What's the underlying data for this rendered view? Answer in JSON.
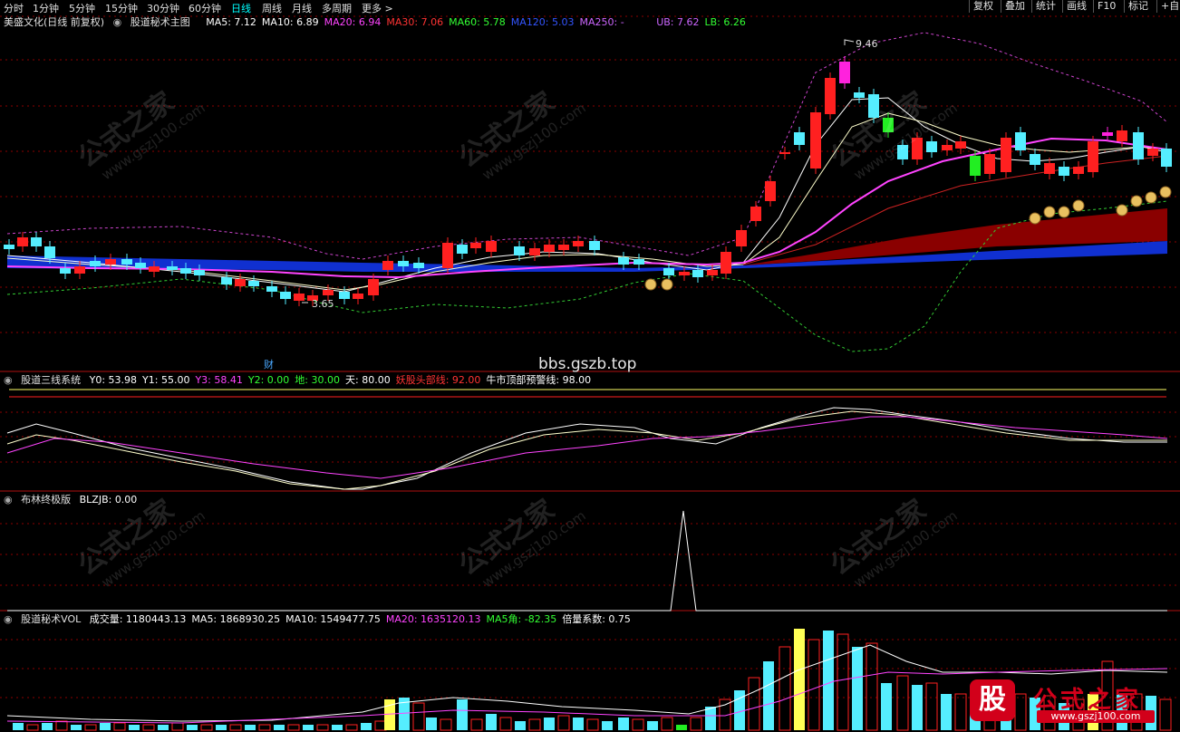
{
  "toolbar": {
    "periods": [
      "分时",
      "1分钟",
      "5分钟",
      "15分钟",
      "30分钟",
      "60分钟",
      "日线",
      "周线",
      "月线",
      "多周期",
      "更多 >"
    ],
    "active_period": "日线",
    "right_buttons": [
      "复权",
      "叠加",
      "统计",
      "画线",
      "F10",
      "标记",
      "+自"
    ]
  },
  "main_panel": {
    "stock_title": "美盛文化(日线 前复权)",
    "indicator_name": "股道秘术主图",
    "ma_items": [
      {
        "label": "MA5: 7.12",
        "color": "#ffffff"
      },
      {
        "label": "MA10: 6.89",
        "color": "#ffffff"
      },
      {
        "label": "MA20: 6.94",
        "color": "#ff44ff"
      },
      {
        "label": "MA30: 7.06",
        "color": "#ff3333"
      },
      {
        "label": "MA60: 5.78",
        "color": "#33ff33"
      },
      {
        "label": "MA120: 5.03",
        "color": "#3355ff"
      },
      {
        "label": "MA250: -",
        "color": "#cc66ff"
      }
    ],
    "band_items": [
      {
        "label": "UB: 7.62",
        "color": "#cc66ff"
      },
      {
        "label": "LB: 6.26",
        "color": "#33ff33"
      }
    ],
    "high_label": "9.46",
    "low_label": "3.65",
    "cai_label": "财",
    "site_text": "bbs.gszb.top"
  },
  "sub1": {
    "name": "股道三线系统",
    "items": [
      {
        "label": "Y0: 53.98",
        "color": "#ffffff"
      },
      {
        "label": "Y1: 55.00",
        "color": "#ffffff"
      },
      {
        "label": "Y3: 58.41",
        "color": "#ff44ff"
      },
      {
        "label": "Y2: 0.00",
        "color": "#33ff33"
      },
      {
        "label": "地: 30.00",
        "color": "#33ff33"
      },
      {
        "label": "天: 80.00",
        "color": "#ffffff"
      },
      {
        "label": "妖股头部线: 92.00",
        "color": "#ff3333"
      },
      {
        "label": "牛市顶部预警线: 98.00",
        "color": "#ffffff"
      }
    ]
  },
  "sub2": {
    "name": "布林终极版",
    "items": [
      {
        "label": "BLZJB: 0.00",
        "color": "#ffffff"
      }
    ]
  },
  "sub3": {
    "name": "股道秘术VOL",
    "items": [
      {
        "label": "成交量: 1180443.13",
        "color": "#ffffff"
      },
      {
        "label": "MA5: 1868930.25",
        "color": "#ffffff"
      },
      {
        "label": "MA10: 1549477.75",
        "color": "#ffffff"
      },
      {
        "label": "MA20: 1635120.13",
        "color": "#ff44ff"
      },
      {
        "label": "MA5角: -82.35",
        "color": "#33ff33"
      },
      {
        "label": "倍量系数: 0.75",
        "color": "#ffffff"
      }
    ]
  },
  "watermark": {
    "name": "公式之家",
    "url": "www.gszj100.com"
  },
  "logo": {
    "mark": "股",
    "name": "公式之家",
    "url": "www.gszj100.com"
  },
  "colors": {
    "up": "#ff2020",
    "down": "#55eeff",
    "grid": "#8b0000",
    "divider": "#b01010"
  }
}
